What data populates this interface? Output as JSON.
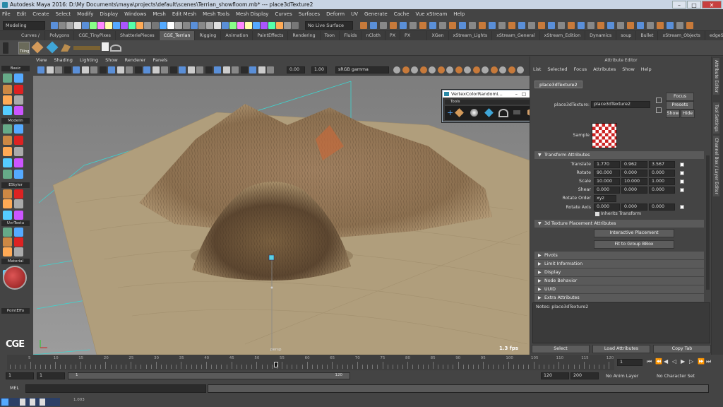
{
  "window": {
    "title": "Autodesk Maya 2016: D:\\My Documents\\maya\\projects\\default\\scenes\\Terrian_showfloom.mb* --- place3dTexture2"
  },
  "menubar": [
    "File",
    "Edit",
    "Create",
    "Select",
    "Modify",
    "Display",
    "Windows",
    "Mesh",
    "Edit Mesh",
    "Mesh Tools",
    "Mesh Display",
    "Curves",
    "Surfaces",
    "Deform",
    "UV",
    "Generate",
    "Cache",
    "Vue xStream",
    "Help"
  ],
  "status": {
    "mode": "Modeling",
    "live_surface": "No Live Surface"
  },
  "shelf_tabs": [
    "Curves / Surfaces",
    "Polygons",
    "CGE_TinyPixes",
    "ShatteriePieces",
    "CGE_Terrian",
    "Rigging",
    "Animation",
    "PaintEffects",
    "Rendering",
    "Toon",
    "Fluids",
    "nCloth",
    "PX",
    "PX Caching",
    "XGen",
    "xStream_Lights",
    "xStream_General",
    "xStream_Edition",
    "Dynamics",
    "soup",
    "Bullet",
    "xStream_Objects",
    "edgeStylerC"
  ],
  "shelf_active": "CGE_Terrian",
  "shelf": {
    "tiling_label": "Tiling"
  },
  "left_sections": [
    "Basic",
    "Modelin",
    "EStyler",
    "UvrTextu",
    "Material",
    "PointEffo"
  ],
  "left_logo": "CGE",
  "viewport": {
    "menu": [
      "View",
      "Shading",
      "Lighting",
      "Show",
      "Renderer",
      "Panels"
    ],
    "exposure": "0.00",
    "gamma": "1.00",
    "colorspace": "sRGB gamma",
    "fps": "1.3 fps",
    "camera": "persp"
  },
  "vcr_window": {
    "title": "VertexColorRandomi...",
    "tools_label": "Tools"
  },
  "attr_editor": {
    "title": "Attribute Editor",
    "menu": [
      "List",
      "Selected",
      "Focus",
      "Attributes",
      "Show",
      "Help"
    ],
    "tab": "place3dTexture2",
    "node_label": "place3dTexture:",
    "node_name": "place3dTexture2",
    "focus": "Focus",
    "presets": "Presets",
    "show": "Show",
    "hide": "Hide",
    "sample": "Sample",
    "transform_section": "Transform Attributes",
    "translate": {
      "label": "Translate",
      "x": "1.770",
      "y": "0.962",
      "z": "3.567"
    },
    "rotate": {
      "label": "Rotate",
      "x": "90.000",
      "y": "0.000",
      "z": "0.000"
    },
    "scale": {
      "label": "Scale",
      "x": "10.000",
      "y": "10.000",
      "z": "1.000"
    },
    "shear": {
      "label": "Shear",
      "x": "0.000",
      "y": "0.000",
      "z": "0.000"
    },
    "rotate_order": {
      "label": "Rotate Order",
      "value": "xyz"
    },
    "rotate_axis": {
      "label": "Rotate Axis",
      "x": "0.000",
      "y": "0.000",
      "z": "0.000"
    },
    "inherits": "Inherits Transform",
    "placement_section": "3d Texture Placement Attributes",
    "interactive": "Interactive Placement",
    "fit": "Fit to Group BBox",
    "collapsed": [
      "Pivots",
      "Limit Information",
      "Display",
      "Node Behavior",
      "UUID",
      "Extra Attributes"
    ],
    "notes": "Notes:  place3dTexture2",
    "btn_select": "Select",
    "btn_load": "Load Attributes",
    "btn_copy": "Copy Tab"
  },
  "right_tabs": [
    "Attribute Editor",
    "Tool Settings",
    "Channel Box / Layer Editor"
  ],
  "timeline": {
    "ticks": [
      "5",
      "10",
      "15",
      "20",
      "25",
      "30",
      "35",
      "40",
      "45",
      "50",
      "55",
      "60",
      "65",
      "70",
      "75",
      "80",
      "85",
      "90",
      "95",
      "100",
      "105",
      "110",
      "115",
      "120"
    ],
    "current_frame": "1"
  },
  "range": {
    "start": "1",
    "start2": "1",
    "slider_start": "1",
    "slider_end": "120",
    "end": "120",
    "end2": "200",
    "anim_layer": "No Anim Layer",
    "char_set": "No Character Set"
  },
  "cmdline": {
    "label": "MEL"
  },
  "taskbar": {
    "coords": "1.003"
  }
}
